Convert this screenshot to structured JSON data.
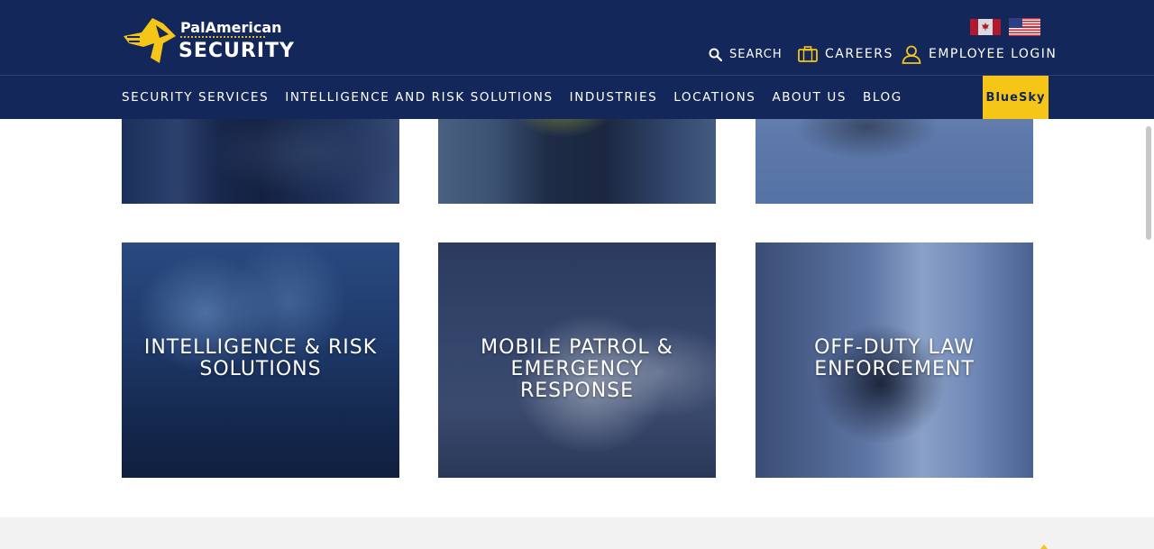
{
  "brand": {
    "name_top": "PalAmerican",
    "name_bottom": "SECURITY",
    "accent_color": "#f5c518",
    "navy_color": "#13275a"
  },
  "header": {
    "flags": [
      {
        "name": "canada-flag-icon"
      },
      {
        "name": "usa-flag-icon"
      }
    ],
    "utility": {
      "search_label": "SEARCH",
      "careers_label": "CAREERS",
      "login_label": "EMPLOYEE LOGIN"
    },
    "nav": [
      {
        "label": "SECURITY SERVICES"
      },
      {
        "label": "INTELLIGENCE AND RISK SOLUTIONS"
      },
      {
        "label": "INDUSTRIES"
      },
      {
        "label": "LOCATIONS"
      },
      {
        "label": "ABOUT US"
      },
      {
        "label": "BLOG"
      }
    ],
    "cta_label": "BlueSky"
  },
  "cards": {
    "top": [
      {
        "label": ""
      },
      {
        "label": ""
      },
      {
        "label": ""
      }
    ],
    "bottom": [
      {
        "label": "INTELLIGENCE & RISK SOLUTIONS"
      },
      {
        "label": "MOBILE PATROL & EMERGENCY RESPONSE"
      },
      {
        "label": "OFF-DUTY LAW ENFORCEMENT"
      }
    ]
  }
}
